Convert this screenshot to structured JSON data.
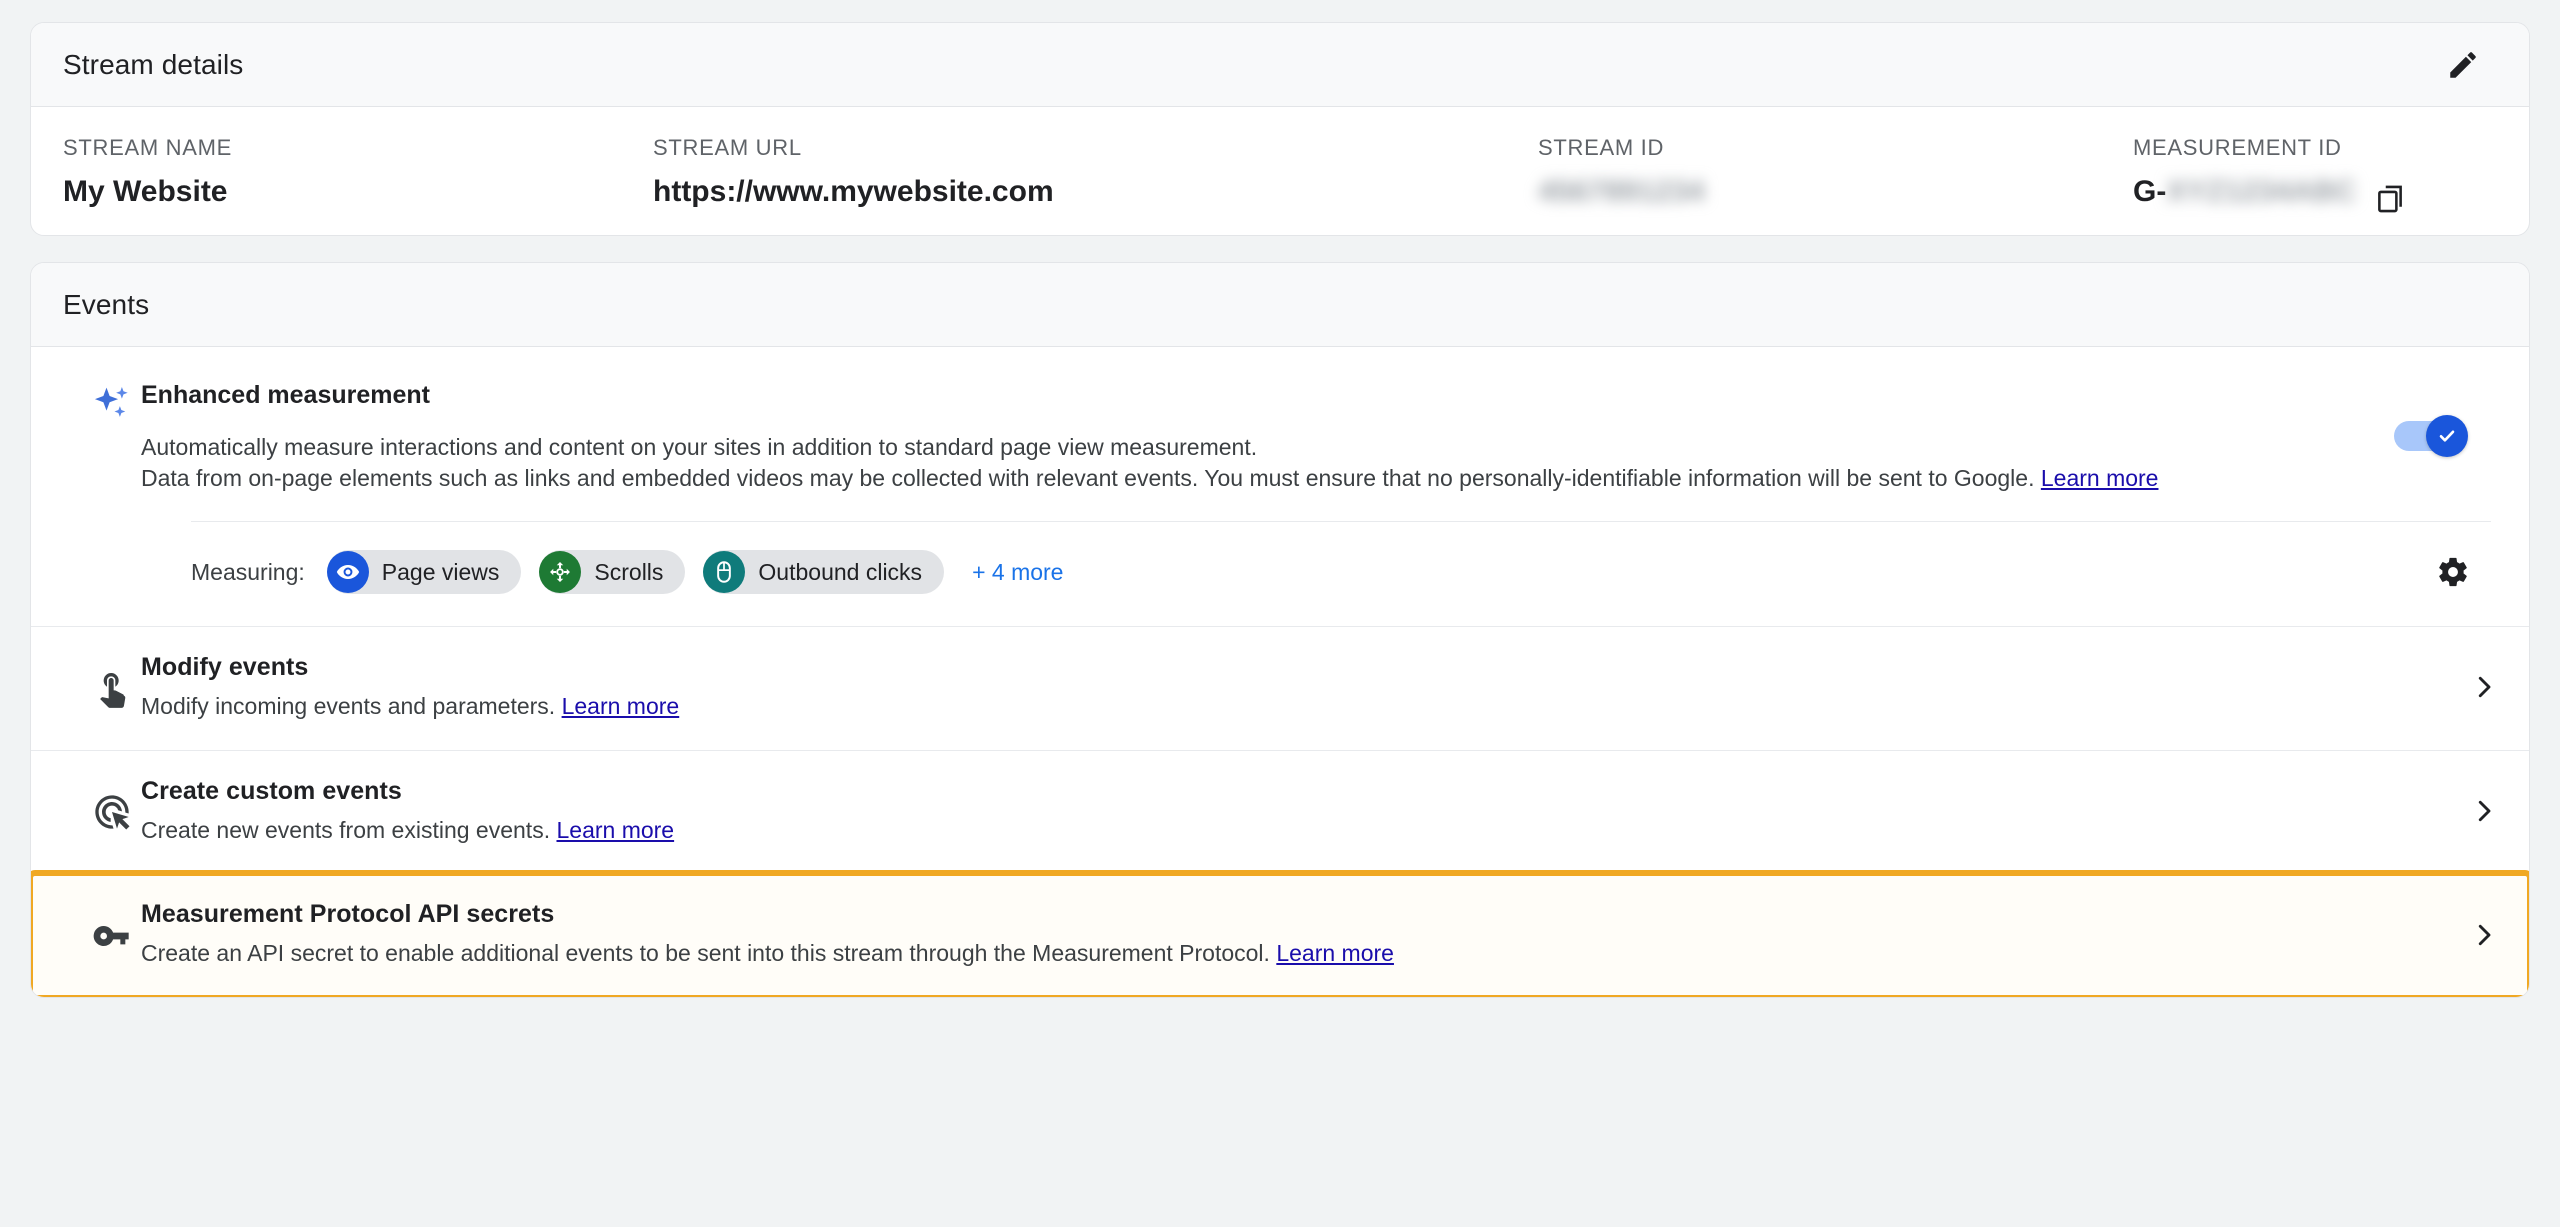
{
  "stream_details": {
    "title": "Stream details",
    "edit_icon": "pencil-icon",
    "fields": [
      {
        "label": "STREAM NAME",
        "value": "My Website"
      },
      {
        "label": "STREAM URL",
        "value": "https://www.mywebsite.com"
      },
      {
        "label": "STREAM ID",
        "value": "",
        "redacted": "4567891234"
      },
      {
        "label": "MEASUREMENT ID",
        "value": "G-",
        "redacted": "XYZ1234ABC"
      }
    ],
    "copy_icon": "copy-icon"
  },
  "events": {
    "title": "Events",
    "enhanced_measurement": {
      "icon": "sparkles-icon",
      "title": "Enhanced measurement",
      "desc_line1": "Automatically measure interactions and content on your sites in addition to standard page view measurement.",
      "desc_line2": "Data from on-page elements such as links and embedded videos may be collected with relevant events. You must ensure that no personally-identifiable information will be sent to Google. ",
      "learn_more": "Learn more",
      "toggle_on": true,
      "toggle_accent": "#1a56db",
      "measuring_label": "Measuring:",
      "chips": [
        {
          "label": "Page views",
          "icon": "eye-icon",
          "color": "#1a56db"
        },
        {
          "label": "Scrolls",
          "icon": "scroll-target-icon",
          "color": "#1e7a34"
        },
        {
          "label": "Outbound clicks",
          "icon": "mouse-icon",
          "color": "#0f7b7b"
        }
      ],
      "more_label": "+ 4 more",
      "settings_icon": "gear-icon"
    },
    "rows": [
      {
        "icon": "touch-app-icon",
        "title": "Modify events",
        "desc": "Modify incoming events and parameters. ",
        "learn_more": "Learn more",
        "chevron": "chevron-right-icon",
        "highlighted": false
      },
      {
        "icon": "ads-click-icon",
        "title": "Create custom events",
        "desc": "Create new events from existing events. ",
        "learn_more": "Learn more",
        "chevron": "chevron-right-icon",
        "highlighted": false
      },
      {
        "icon": "key-icon",
        "title": "Measurement Protocol API secrets",
        "desc": "Create an API secret to enable additional events to be sent into this stream through the Measurement Protocol. ",
        "learn_more": "Learn more",
        "chevron": "chevron-right-icon",
        "highlighted": true,
        "highlight_color": "#f0a823"
      }
    ]
  }
}
